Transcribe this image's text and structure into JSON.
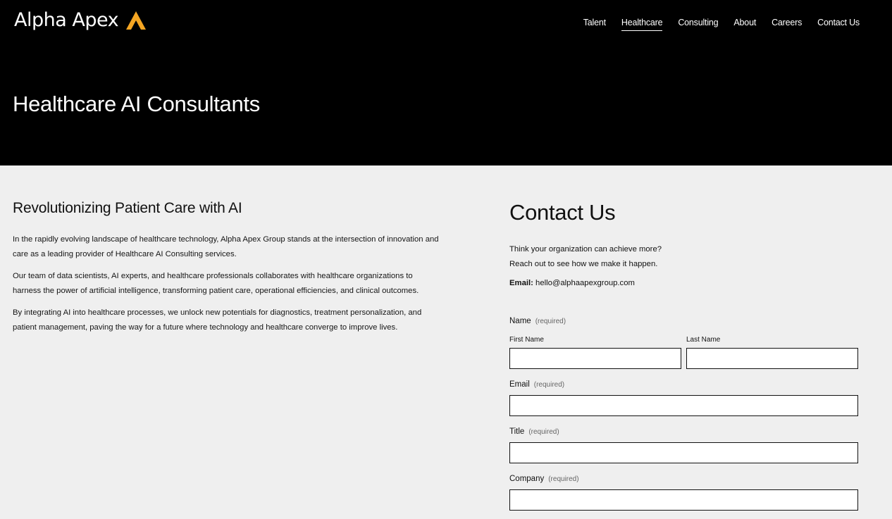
{
  "brand": {
    "name": "Alpha Apex",
    "logo_icon": "triangle-apex-icon",
    "accent": "#f5a623"
  },
  "nav": {
    "items": [
      {
        "label": "Talent",
        "active": false
      },
      {
        "label": "Healthcare",
        "active": true
      },
      {
        "label": "Consulting",
        "active": false
      },
      {
        "label": "About",
        "active": false
      },
      {
        "label": "Careers",
        "active": false
      },
      {
        "label": "Contact Us",
        "active": false
      }
    ]
  },
  "hero": {
    "title": "Healthcare AI Consultants"
  },
  "content": {
    "heading": "Revolutionizing Patient Care with AI",
    "paragraphs": [
      "In the rapidly evolving landscape of healthcare technology, Alpha Apex Group stands at the intersection of innovation and care as a leading provider of Healthcare AI Consulting services.",
      "Our team of data scientists, AI experts, and healthcare professionals collaborates with healthcare organizations to harness the power of artificial intelligence, transforming patient care, operational efficiencies, and clinical outcomes.",
      "By integrating AI into healthcare processes, we unlock new potentials for diagnostics, treatment personalization, and patient management, paving the way for a future where technology and healthcare converge to improve lives."
    ]
  },
  "contact": {
    "title": "Contact Us",
    "intro_line1": "Think your organization can achieve more?",
    "intro_line2": "Reach out to see how we make it happen.",
    "email_label": "Email:",
    "email_value": "hello@alphaapexgroup.com"
  },
  "form": {
    "required_text": "(required)",
    "name_label": "Name",
    "first_name_label": "First Name",
    "first_name_value": "",
    "last_name_label": "Last Name",
    "last_name_value": "",
    "email_label": "Email",
    "email_value": "",
    "title_label": "Title",
    "title_value": "",
    "company_label": "Company",
    "company_value": ""
  }
}
